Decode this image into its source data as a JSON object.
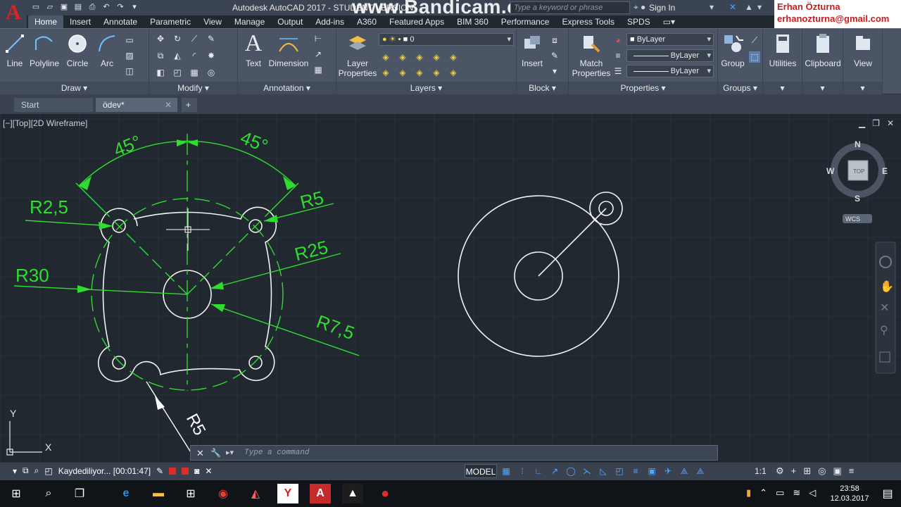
{
  "title": {
    "app_title": "Autodesk AutoCAD 2017 - STUDENT VERSION",
    "watermark": "www.Bandicam.com",
    "search_placeholder": "Type a keyword or phrase",
    "sign_in": "Sign In",
    "creator_name": "Erhan Özturna",
    "creator_email": "erhanozturna@gmail.com"
  },
  "ribbon_tabs": [
    "Home",
    "Insert",
    "Annotate",
    "Parametric",
    "View",
    "Manage",
    "Output",
    "Add-ins",
    "A360",
    "Featured Apps",
    "BIM 360",
    "Performance",
    "Express Tools",
    "SPDS"
  ],
  "ribbon": {
    "draw": {
      "title": "Draw",
      "buttons": [
        "Line",
        "Polyline",
        "Circle",
        "Arc"
      ]
    },
    "modify": {
      "title": "Modify"
    },
    "annotation": {
      "title": "Annotation",
      "buttons": [
        "Text",
        "Dimension"
      ]
    },
    "layers": {
      "title": "Layers",
      "button_line1": "Layer",
      "button_line2": "Properties",
      "current_layer": "0"
    },
    "block": {
      "title": "Block",
      "button": "Insert"
    },
    "properties": {
      "title": "Properties",
      "button_line1": "Match",
      "button_line2": "Properties",
      "color": "ByLayer",
      "linetype": "ByLayer",
      "lineweight": "ByLayer"
    },
    "groups": {
      "title": "Groups",
      "button": "Group"
    },
    "utilities": "Utilities",
    "clipboard": "Clipboard",
    "view": "View"
  },
  "file_tabs": {
    "start": "Start",
    "current": "ödev*"
  },
  "viewport": {
    "label": "[−][Top][2D Wireframe]",
    "viewcube": {
      "n": "N",
      "s": "S",
      "e": "E",
      "w": "W",
      "top": "TOP",
      "wcs": "WCS"
    },
    "ucs": {
      "x": "X",
      "y": "Y"
    }
  },
  "dimensions": {
    "angle_left": "45°",
    "angle_right": "45°",
    "r2_5": "R2,5",
    "r5_top": "R5",
    "r25": "R25",
    "r30": "R30",
    "r7_5": "R7,5",
    "r5_bottom": "R5"
  },
  "command_line": {
    "placeholder": "Type a command"
  },
  "status_bar": {
    "recorder_text": "Kaydediliyor... [00:01:47]",
    "model": "MODEL",
    "scale": "1:1"
  },
  "clock": {
    "time": "23:58",
    "date": "12.03.2017"
  },
  "colors": {
    "dimension": "#2fdc2f",
    "geometry": "#ffffff",
    "background": "#212830",
    "ribbon": "#4b5566"
  }
}
